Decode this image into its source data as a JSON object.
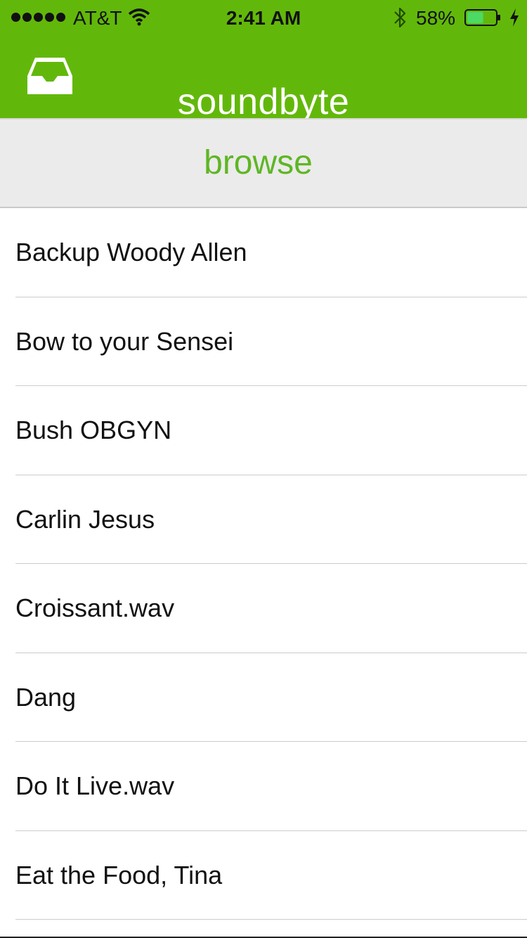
{
  "status_bar": {
    "carrier": "AT&T",
    "time": "2:41 AM",
    "battery_percent": "58%",
    "battery_level": 0.58,
    "signal_bars": 5,
    "icons": [
      "signal-dots-icon",
      "wifi-icon",
      "bluetooth-icon",
      "battery-icon",
      "charging-bolt-icon"
    ]
  },
  "header": {
    "app_name": "soundbyte",
    "left_button_icon": "inbox-tray-icon",
    "background_color": "#62b80a"
  },
  "section": {
    "title": "browse",
    "title_color": "#5fb624",
    "background_color": "#ebebeb"
  },
  "sounds": [
    {
      "name": "Backup Woody Allen"
    },
    {
      "name": "Bow to your Sensei"
    },
    {
      "name": "Bush OBGYN"
    },
    {
      "name": "Carlin Jesus"
    },
    {
      "name": "Croissant.wav"
    },
    {
      "name": "Dang"
    },
    {
      "name": "Do It Live.wav"
    },
    {
      "name": "Eat the Food, Tina"
    }
  ]
}
